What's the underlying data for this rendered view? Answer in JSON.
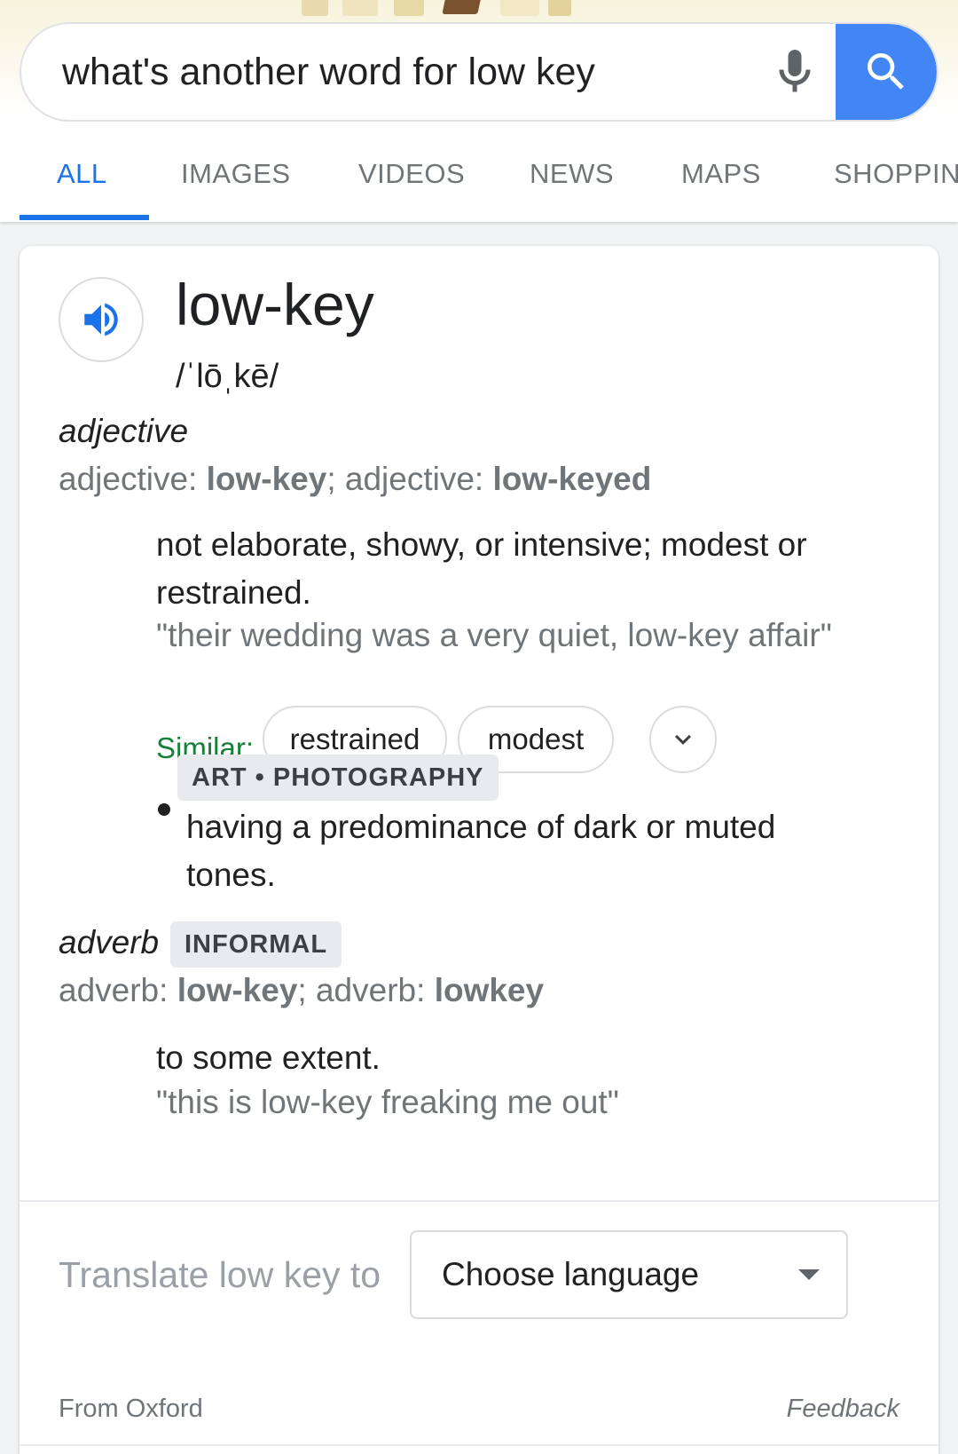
{
  "search": {
    "query": "what's another word for low key",
    "mic_icon": "microphone-icon",
    "search_icon": "magnifier-icon"
  },
  "tabs": [
    {
      "label": "ALL",
      "active": true
    },
    {
      "label": "IMAGES",
      "active": false
    },
    {
      "label": "VIDEOS",
      "active": false
    },
    {
      "label": "NEWS",
      "active": false
    },
    {
      "label": "MAPS",
      "active": false
    },
    {
      "label": "SHOPPING",
      "active": false
    }
  ],
  "dictionary": {
    "word": "low-key",
    "phonetic": "/ˈlōˌkē/",
    "speaker_icon": "speaker-icon",
    "adjective": {
      "pos": "adjective",
      "forms_prefix1": "adjective: ",
      "form1": "low-key",
      "forms_sep": "; adjective: ",
      "form2": "low-keyed",
      "definition": "not elaborate, showy, or intensive; modest or restrained.",
      "example": "\"their wedding was a very quiet, low-key affair\"",
      "similar_label": "Similar:",
      "similar": [
        "restrained",
        "modest"
      ],
      "sense2_tag": "ART • PHOTOGRAPHY",
      "sense2_definition": "having a predominance of dark or muted tones."
    },
    "adverb": {
      "pos": "adverb",
      "register": "INFORMAL",
      "forms_prefix1": "adverb: ",
      "form1": "low-key",
      "forms_sep": "; adverb: ",
      "form2": "lowkey",
      "definition": "to some extent.",
      "example": "\"this is low-key freaking me out\""
    }
  },
  "translate": {
    "label": "Translate low key to",
    "select_value": "Choose language"
  },
  "footer": {
    "source": "From Oxford",
    "feedback": "Feedback"
  },
  "colors": {
    "accent": "#1a73e8",
    "search_button": "#4285f4",
    "similar_label": "#188038"
  }
}
